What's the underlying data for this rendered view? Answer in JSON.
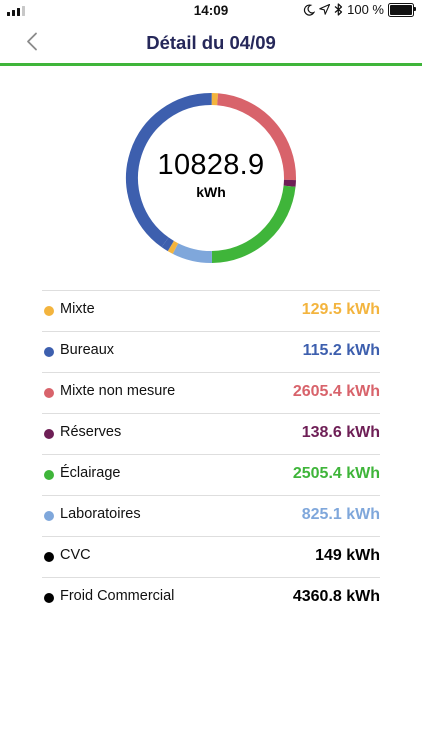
{
  "status_bar": {
    "time": "14:09",
    "battery": "100 %",
    "icons": [
      "moon-icon",
      "location-arrow-icon",
      "bluetooth-icon",
      "battery-icon",
      "signal-icon"
    ]
  },
  "header": {
    "title": "Détail du 04/09",
    "back_icon": "chevron-left-icon",
    "accent_color": "#3fb53a"
  },
  "donut": {
    "total": "10828.9",
    "unit": "kWh"
  },
  "chart_data": {
    "type": "pie",
    "categories": [
      "Mixte",
      "Bureaux",
      "Mixte non mesure",
      "Réserves",
      "Éclairage",
      "Laboratoires",
      "CVC",
      "Froid Commercial"
    ],
    "values": [
      129.5,
      115.2,
      2605.4,
      138.6,
      2505.4,
      825.1,
      149,
      4360.8
    ],
    "colors": [
      "#f3b43e",
      "#3d5fae",
      "#d8636b",
      "#6e1f56",
      "#3fb53a",
      "#7fa7db",
      "#000000",
      "#000000"
    ]
  },
  "legend": [
    {
      "label": "Mixte",
      "value": "129.5 kWh",
      "color": "#f3b43e"
    },
    {
      "label": "Bureaux",
      "value": "115.2 kWh",
      "color": "#3d5fae"
    },
    {
      "label": "Mixte non mesure",
      "value": "2605.4 kWh",
      "color": "#d8636b"
    },
    {
      "label": "Réserves",
      "value": "138.6 kWh",
      "color": "#6e1f56"
    },
    {
      "label": "Éclairage",
      "value": "2505.4 kWh",
      "color": "#3fb53a"
    },
    {
      "label": "Laboratoires",
      "value": "825.1 kWh",
      "color": "#7fa7db"
    },
    {
      "label": "CVC",
      "value": "149 kWh",
      "color": "#000000"
    },
    {
      "label": "Froid Commercial",
      "value": "4360.8 kWh",
      "color": "#000000"
    }
  ]
}
